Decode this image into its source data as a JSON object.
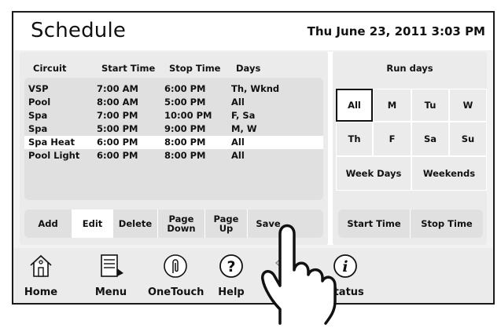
{
  "header": {
    "title": "Schedule",
    "datetime": "Thu June 23, 2011  3:03 PM"
  },
  "table": {
    "columns": [
      "Circuit",
      "Start Time",
      "Stop Time",
      "Days"
    ],
    "rows": [
      [
        "VSP",
        "7:00 AM",
        "6:00 PM",
        "Th, Wknd"
      ],
      [
        "Pool",
        "8:00 AM",
        "5:00 PM",
        "All"
      ],
      [
        "Spa",
        "7:00 PM",
        "10:00 PM",
        "F, Sa"
      ],
      [
        "Spa",
        "5:00 PM",
        "9:00 PM",
        "M, W"
      ],
      [
        "Spa Heat",
        "6:00 PM",
        "8:00 PM",
        "All"
      ],
      [
        "Pool Light",
        "6:00 PM",
        "8:00 PM",
        "All"
      ]
    ],
    "selected_row_index": 4
  },
  "buttons": {
    "add": "Add",
    "edit": "Edit",
    "delete": "Delete",
    "page_down_1": "Page",
    "page_down_2": "Down",
    "page_up_1": "Page",
    "page_up_2": "Up",
    "save": "Save"
  },
  "run_days": {
    "label": "Run days",
    "days": [
      "All",
      "M",
      "Tu",
      "W",
      "Th",
      "F",
      "Sa",
      "Su"
    ],
    "selected": "All",
    "week_days": "Week Days",
    "weekends": "Weekends",
    "start_time": "Start Time",
    "stop_time": "Stop Time"
  },
  "toolbar": {
    "items": [
      {
        "label": "Home",
        "icon": "home-icon"
      },
      {
        "label": "Menu",
        "icon": "menu-icon"
      },
      {
        "label": "OneTouch",
        "icon": "onetouch-icon"
      },
      {
        "label": "Help",
        "icon": "help-icon"
      },
      {
        "label": "",
        "icon": "back-icon"
      },
      {
        "label": "Status",
        "icon": "status-icon"
      }
    ],
    "help_glyph": "?",
    "status_glyph": "i"
  },
  "colors": {
    "panel": "#ebebeb",
    "inner": "#e0e0e0",
    "highlight": "#ffffff",
    "border": "#1a1a1a"
  }
}
